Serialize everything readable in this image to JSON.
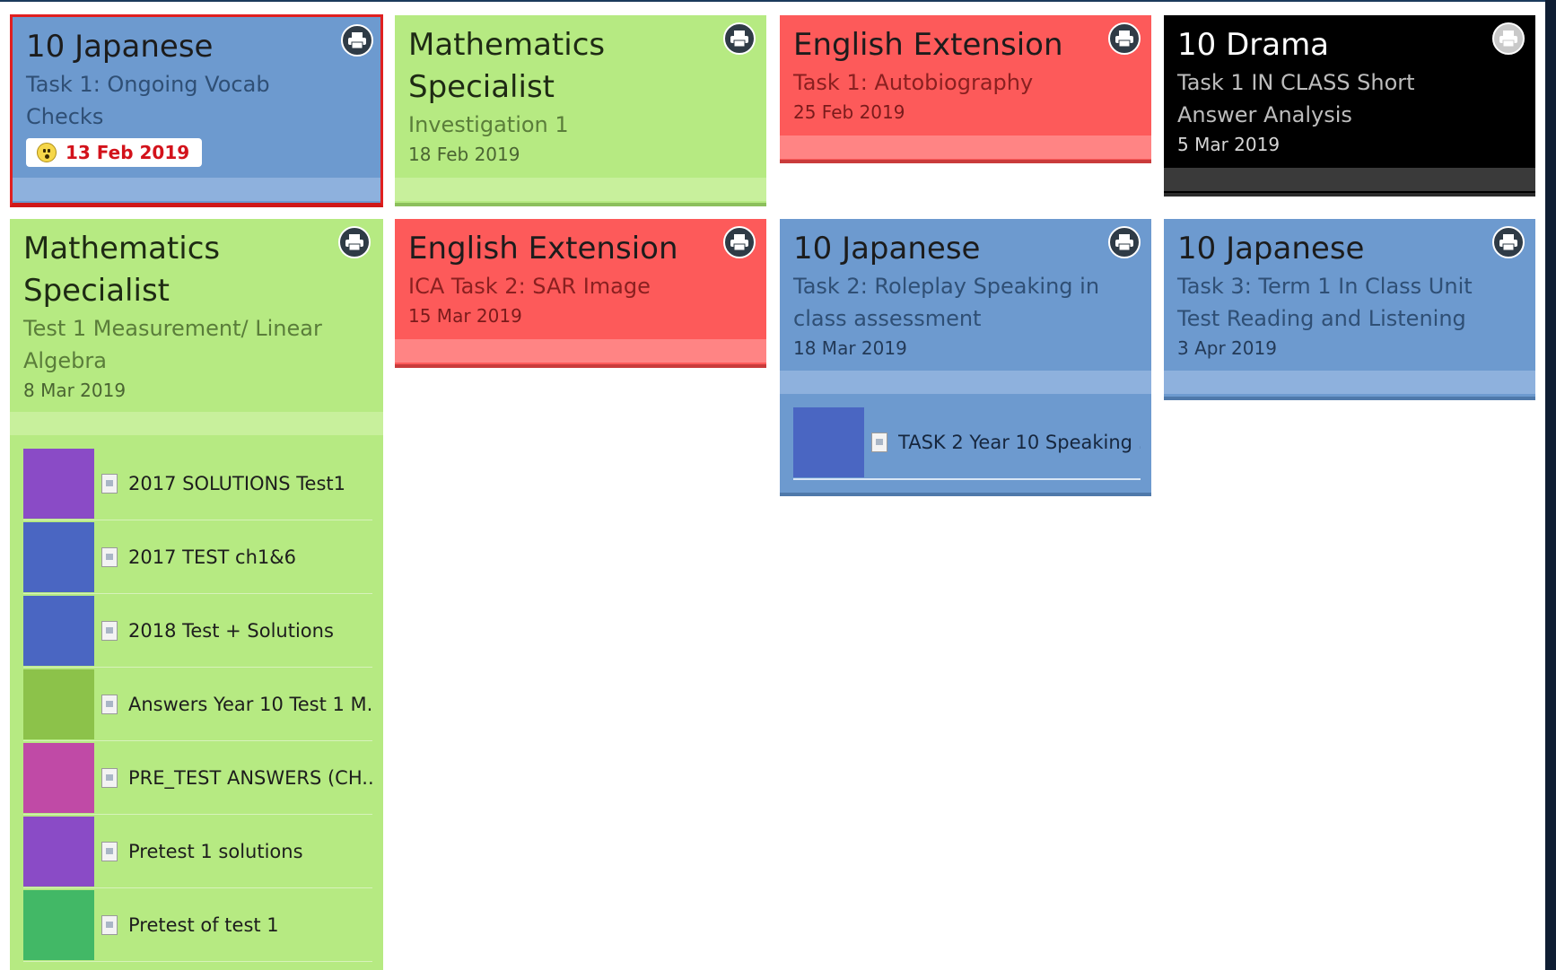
{
  "colors": {
    "blue": "#6d9acf",
    "green": "#b6ea82",
    "red": "#fd5a5a",
    "black": "#000000",
    "due_alert": "#d3121b"
  },
  "cards": [
    {
      "title": "10 Japanese",
      "subtitle_line1": "Task 1: Ongoing Vocab",
      "subtitle_line2": "Checks",
      "date": "13 Feb 2019",
      "overdue": true,
      "icon": "printer-icon"
    },
    {
      "title_line1": "Mathematics",
      "title_line2": "Specialist",
      "subtitle": "Investigation 1",
      "date": "18 Feb 2019",
      "icon": "printer-icon"
    },
    {
      "title": "English Extension",
      "subtitle": "Task 1: Autobiography",
      "date": "25 Feb 2019",
      "icon": "printer-icon"
    },
    {
      "title": "10 Drama",
      "subtitle_line1": "Task 1 IN CLASS Short",
      "subtitle_line2": "Answer Analysis",
      "date": "5 Mar 2019",
      "icon": "printer-icon"
    },
    {
      "title_line1": "Mathematics",
      "title_line2": "Specialist",
      "subtitle_line1": "Test 1 Measurement/ Linear",
      "subtitle_line2": "Algebra",
      "date": "8 Mar 2019",
      "icon": "printer-icon",
      "attachments": [
        {
          "name": "2017 SOLUTIONS Test1",
          "color": "#8a4bc6"
        },
        {
          "name": "2017 TEST ch1&6",
          "color": "#4a66c2"
        },
        {
          "name": "2018 Test + Solutions",
          "color": "#4a66c2"
        },
        {
          "name": "Answers Year 10 Test 1 M...",
          "color": "#8cc24a"
        },
        {
          "name": "PRE_TEST ANSWERS (CH...",
          "color": "#c04aa6"
        },
        {
          "name": "Pretest 1 solutions",
          "color": "#8a4bc6"
        },
        {
          "name": "Pretest of test 1",
          "color": "#42b866"
        }
      ]
    },
    {
      "title": "English Extension",
      "subtitle": "ICA Task 2: SAR Image",
      "date": "15 Mar 2019",
      "icon": "printer-icon"
    },
    {
      "title": "10 Japanese",
      "subtitle_line1": "Task 2: Roleplay Speaking in",
      "subtitle_line2": "class assessment",
      "date": "18 Mar 2019",
      "icon": "printer-icon",
      "attachments": [
        {
          "name": "TASK 2 Year 10 Speaking ...",
          "color": "#4a66c2"
        }
      ]
    },
    {
      "title": "10 Japanese",
      "subtitle_line1": "Task 3: Term 1 In Class Unit",
      "subtitle_line2": "Test Reading and Listening",
      "date": "3 Apr 2019",
      "icon": "printer-icon"
    }
  ]
}
